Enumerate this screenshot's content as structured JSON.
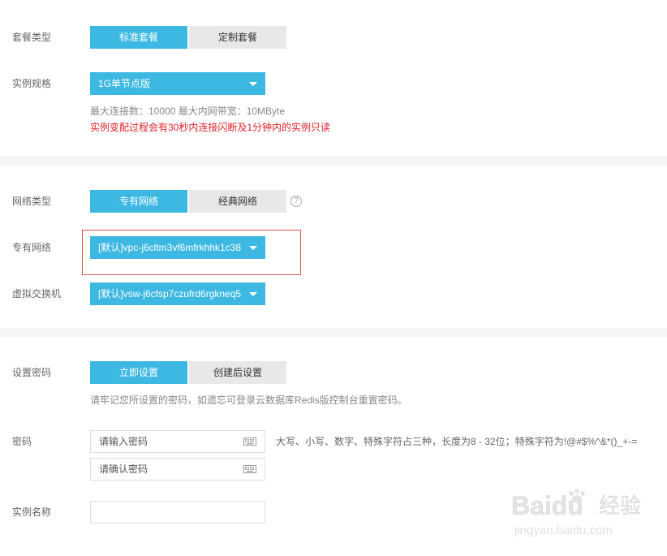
{
  "plan": {
    "label": "套餐类型",
    "options": [
      "标准套餐",
      "定制套餐"
    ]
  },
  "spec": {
    "label": "实例规格",
    "value": "1G单节点版",
    "info": "最大连接数：10000 最大内网带宽：10MByte",
    "warning": "实例变配过程会有30秒内连接闪断及1分钟内的实例只读"
  },
  "network": {
    "type_label": "网络类型",
    "type_options": [
      "专有网络",
      "经典网络"
    ],
    "vpc_label": "专有网络",
    "vpc_value": "[默认]vpc-j6cltm3vf6mfrkhhk1c38",
    "vswitch_label": "虚拟交换机",
    "vswitch_value": "[默认]vsw-j6cfsp7czufrd6rgkneq5"
  },
  "password": {
    "set_label": "设置密码",
    "set_options": [
      "立即设置",
      "创建后设置"
    ],
    "reminder": "请牢记您所设置的密码，如遗忘可登录云数据库Redis版控制台重置密码。",
    "label": "密码",
    "placeholder": "请输入密码",
    "confirm_placeholder": "请确认密码",
    "rule": "大写、小写、数字、特殊字符占三种，长度为8 - 32位；特殊字符为!@#$%^&*()_+-="
  },
  "instance_name": {
    "label": "实例名称",
    "value": ""
  },
  "colors": {
    "accent": "#3db8e2",
    "inactive": "#e8e8e8",
    "warning": "#e0202a",
    "highlight_box": "#d9534f"
  },
  "watermark": {
    "brand": "Baidu",
    "cn": "经验",
    "url": "jingyan.baidu.com"
  }
}
